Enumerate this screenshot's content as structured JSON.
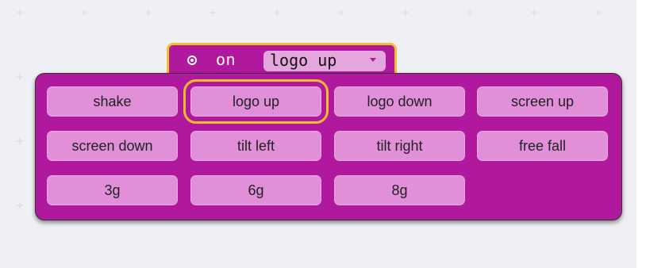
{
  "event_block": {
    "keyword": "on",
    "selected": "logo up"
  },
  "options": [
    "shake",
    "logo up",
    "logo down",
    "screen up",
    "screen down",
    "tilt left",
    "tilt right",
    "free fall",
    "3g",
    "6g",
    "8g"
  ],
  "selected_index": 1,
  "colors": {
    "block": "#b0199e",
    "option": "#e08fd8",
    "highlight": "#f5be2b",
    "workspace": "#eef0f3"
  }
}
